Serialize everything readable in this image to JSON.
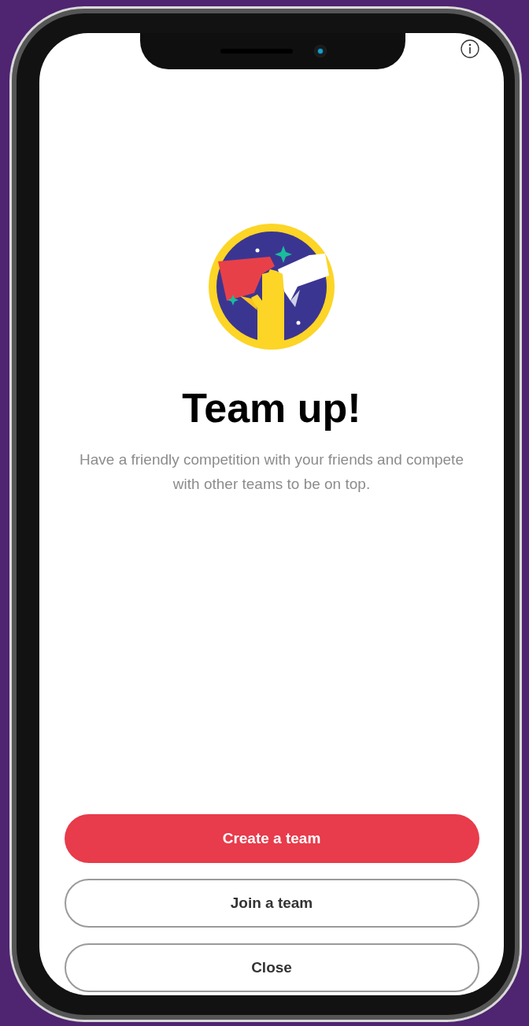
{
  "title": "Team up!",
  "description": "Have a friendly competition with your friends and compete with other teams to be on top.",
  "buttons": [
    {
      "label": "Create a team",
      "kind": "primary"
    },
    {
      "label": "Join a team",
      "kind": "outline"
    },
    {
      "label": "Close",
      "kind": "outline"
    }
  ]
}
